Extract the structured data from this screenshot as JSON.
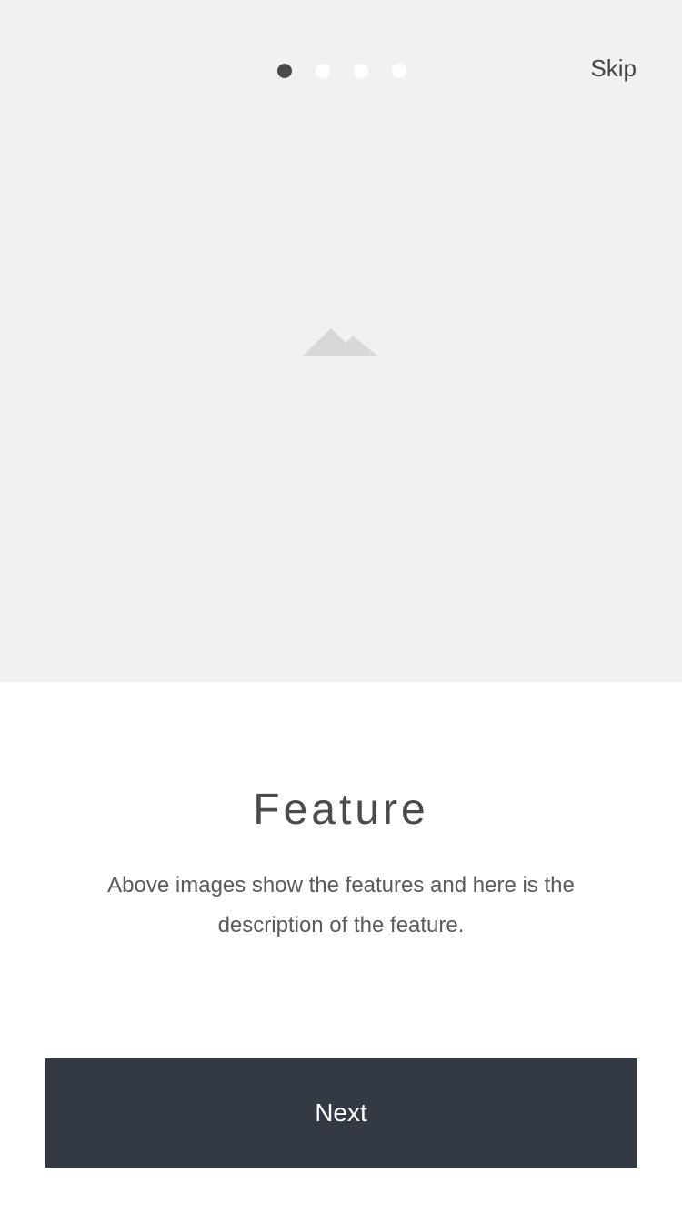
{
  "onboarding": {
    "skip_label": "Skip",
    "pager": {
      "total": 4,
      "active_index": 0
    },
    "image_icon": "image-placeholder-icon",
    "title": "Feature",
    "description": "Above images show the features and here is the description of the feature.",
    "next_label": "Next"
  },
  "colors": {
    "hero_background": "#f1f1f1",
    "dot_active": "#4a4a4a",
    "dot_inactive": "#ffffff",
    "button_background": "#333a44",
    "button_text": "#ffffff"
  }
}
